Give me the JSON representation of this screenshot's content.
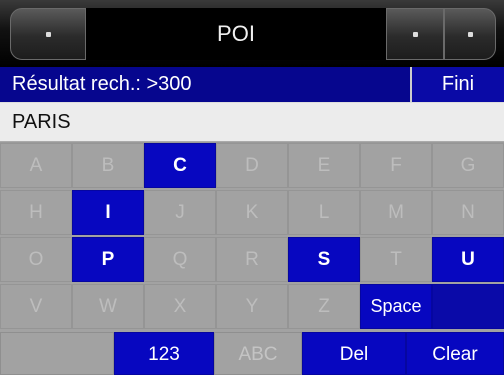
{
  "header": {
    "title": "POI"
  },
  "status": {
    "result_label": "Résultat rech.: >300",
    "done_label": "Fini"
  },
  "search": {
    "value": "PARIS"
  },
  "keyboard": {
    "rows": [
      [
        {
          "k": "A",
          "on": false
        },
        {
          "k": "B",
          "on": false
        },
        {
          "k": "C",
          "on": true
        },
        {
          "k": "D",
          "on": false
        },
        {
          "k": "E",
          "on": false
        },
        {
          "k": "F",
          "on": false
        },
        {
          "k": "G",
          "on": false
        }
      ],
      [
        {
          "k": "H",
          "on": false
        },
        {
          "k": "I",
          "on": true
        },
        {
          "k": "J",
          "on": false
        },
        {
          "k": "K",
          "on": false
        },
        {
          "k": "L",
          "on": false
        },
        {
          "k": "M",
          "on": false
        },
        {
          "k": "N",
          "on": false
        }
      ],
      [
        {
          "k": "O",
          "on": false
        },
        {
          "k": "P",
          "on": true
        },
        {
          "k": "Q",
          "on": false
        },
        {
          "k": "R",
          "on": false
        },
        {
          "k": "S",
          "on": true
        },
        {
          "k": "T",
          "on": false
        },
        {
          "k": "U",
          "on": true
        }
      ],
      [
        {
          "k": "V",
          "on": false
        },
        {
          "k": "W",
          "on": false
        },
        {
          "k": "X",
          "on": false
        },
        {
          "k": "Y",
          "on": false
        },
        {
          "k": "Z",
          "on": false
        },
        {
          "k": "Space",
          "on": true
        },
        {
          "k": "",
          "on": true
        }
      ]
    ],
    "bottom": {
      "numbers": "123",
      "letters": "ABC",
      "delete": "Del",
      "clear": "Clear"
    }
  },
  "colors": {
    "accent_blue": "#0707c0",
    "status_bar": "#06068e",
    "disabled_key": "#a2a2a2"
  }
}
